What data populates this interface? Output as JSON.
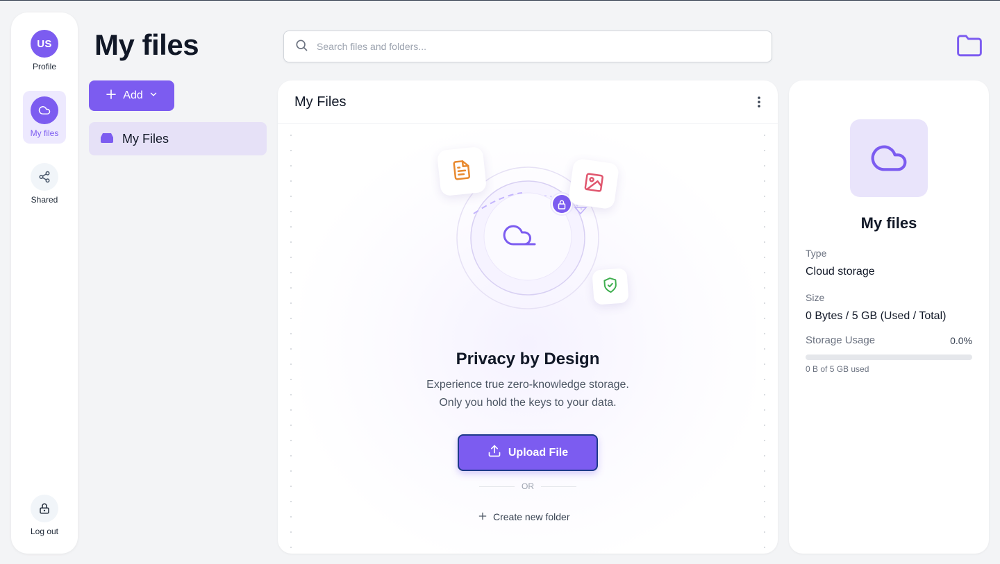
{
  "nav": {
    "avatar_initials": "US",
    "profile_label": "Profile",
    "my_files_label": "My files",
    "shared_label": "Shared",
    "logout_label": "Log out"
  },
  "page": {
    "title": "My files"
  },
  "sidebar": {
    "add_label": "Add",
    "tree": [
      {
        "label": "My Files"
      }
    ]
  },
  "search": {
    "placeholder": "Search files and folders...",
    "value": ""
  },
  "main": {
    "panel_title": "My Files",
    "empty_state": {
      "title": "Privacy by Design",
      "description": "Experience true zero-knowledge storage. Only you hold the keys to your data.",
      "upload_label": "Upload File",
      "or_label": "OR",
      "create_folder_label": "Create new folder"
    }
  },
  "details": {
    "name": "My files",
    "type_label": "Type",
    "type_value": "Cloud storage",
    "size_label": "Size",
    "size_value": "0 Bytes / 5 GB (Used / Total)",
    "usage_label": "Storage Usage",
    "usage_percent": "0.0%",
    "usage_fraction": 0.0,
    "usage_detail": "0 B of 5 GB used"
  },
  "colors": {
    "accent": "#7c5cf0",
    "accent_light": "#ede9fe",
    "background": "#f3f4f6",
    "doc_icon": "#e8892e",
    "image_icon": "#e0566e",
    "shield_icon": "#3fae4f"
  }
}
